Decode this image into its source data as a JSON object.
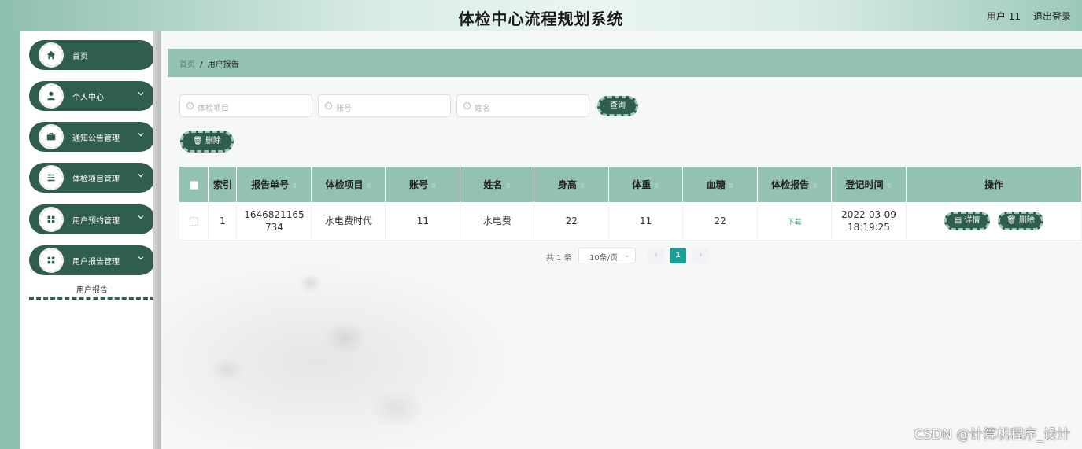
{
  "header": {
    "title": "体检中心流程规划系统",
    "user": "用户 11",
    "logout": "退出登录"
  },
  "sidebar": {
    "items": [
      {
        "label": "首页",
        "icon": "home-icon"
      },
      {
        "label": "个人中心",
        "icon": "user-icon"
      },
      {
        "label": "通知公告管理",
        "icon": "briefcase-icon"
      },
      {
        "label": "体检项目管理",
        "icon": "list-icon"
      },
      {
        "label": "用户预约管理",
        "icon": "grid-icon"
      },
      {
        "label": "用户报告管理",
        "icon": "grid-icon"
      }
    ],
    "submenu": "用户报告"
  },
  "breadcrumb": {
    "home": "首页",
    "separator": "/",
    "current": "用户报告"
  },
  "search": {
    "placeholder_project": "体检项目",
    "placeholder_account": "账号",
    "placeholder_name": "姓名",
    "query_button": "查询"
  },
  "toolbar": {
    "delete_label": "删除"
  },
  "table": {
    "headers": [
      "索引",
      "报告单号",
      "体检项目",
      "账号",
      "姓名",
      "身高",
      "体重",
      "血糖",
      "体检报告",
      "登记时间",
      "操作"
    ],
    "rows": [
      {
        "index": "1",
        "report_no": "1646821165734",
        "project": "水电费时代",
        "account": "11",
        "name": "水电费",
        "height": "22",
        "weight": "11",
        "blood_sugar": "22",
        "report": "下载",
        "time": "2022-03-09 18:19:25",
        "detail_label": "详情",
        "delete_label": "删除"
      }
    ]
  },
  "pagination": {
    "total": "共 1 条",
    "page_size": "10条/页",
    "current": "1"
  },
  "watermark": "CSDN @计算机程序_设计",
  "colors": {
    "accent_dark": "#2f5d4f",
    "accent_light": "#93c2b0",
    "page_active": "#19a097"
  }
}
